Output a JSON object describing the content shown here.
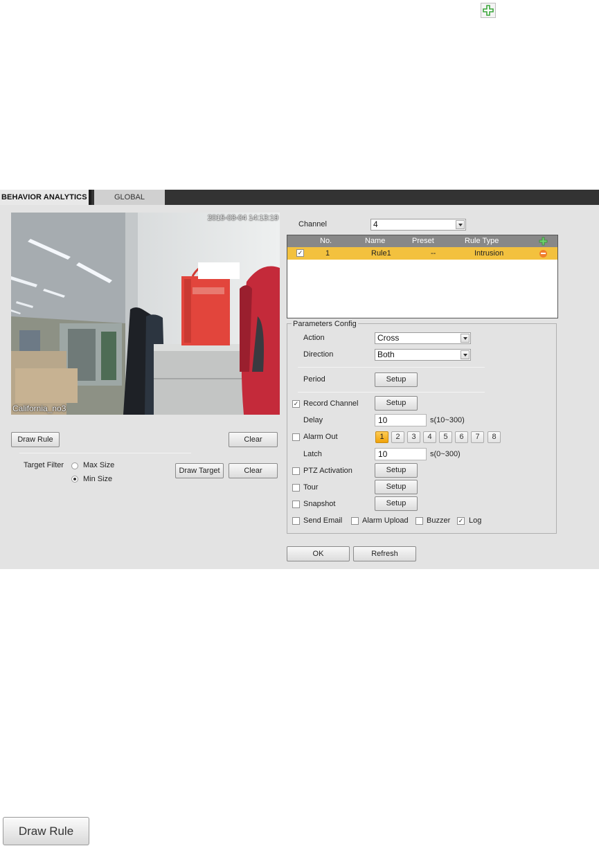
{
  "colors": {
    "tabbar_bg": "#333333",
    "panel_bg": "#e3e3e3",
    "selected_row": "#f3c13e",
    "plus_green": "#3aa53a",
    "minus_orange": "#f07e2c",
    "active_number": "#f0a20a"
  },
  "icons": {
    "top_add": "plus-icon",
    "table_add": "plus-icon",
    "row_delete": "minus-icon",
    "dropdown": "chevron-down-icon"
  },
  "tabs": {
    "behavior": "BEHAVIOR ANALYTICS",
    "global": "GLOBAL"
  },
  "video": {
    "timestamp": "2015-03-04 14:13:19",
    "camera_name": "California_no3"
  },
  "left": {
    "draw_rule": "Draw Rule",
    "clear": "Clear",
    "target_filter": "Target Filter",
    "max_size": "Max Size",
    "min_size": "Min Size",
    "selected_size": "Min Size",
    "draw_target": "Draw Target",
    "clear2": "Clear"
  },
  "channel": {
    "label": "Channel",
    "value": "4"
  },
  "rules_table": {
    "headers": [
      "No.",
      "Name",
      "Preset",
      "Rule Type"
    ],
    "rows": [
      {
        "checked": true,
        "no": "1",
        "name": "Rule1",
        "preset": "--",
        "rule_type": "Intrusion"
      }
    ]
  },
  "params": {
    "legend": "Parameters Config",
    "action_label": "Action",
    "action_value": "Cross",
    "direction_label": "Direction",
    "direction_value": "Both",
    "period_label": "Period",
    "setup": "Setup",
    "record_channel": "Record Channel",
    "record_channel_checked": true,
    "delay_label": "Delay",
    "delay_value": "10",
    "delay_range": "s(10~300)",
    "alarm_out": "Alarm Out",
    "alarm_out_checked": false,
    "alarm_outputs": [
      "1",
      "2",
      "3",
      "4",
      "5",
      "6",
      "7",
      "8"
    ],
    "alarm_output_selected": "1",
    "latch_label": "Latch",
    "latch_value": "10",
    "latch_range": "s(0~300)",
    "ptz_activation": "PTZ Activation",
    "tour": "Tour",
    "snapshot": "Snapshot",
    "send_email": "Send Email",
    "alarm_upload": "Alarm Upload",
    "buzzer": "Buzzer",
    "log": "Log",
    "log_checked": true
  },
  "footer": {
    "ok": "OK",
    "refresh": "Refresh"
  },
  "big_button": "Draw Rule"
}
